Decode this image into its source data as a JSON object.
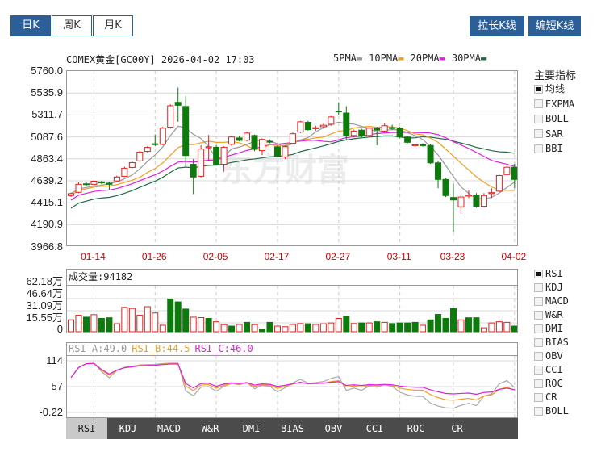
{
  "period_tabs": [
    {
      "label": "日K",
      "active": true
    },
    {
      "label": "周K",
      "active": false
    },
    {
      "label": "月K",
      "active": false
    }
  ],
  "buttons": {
    "stretch": "拉长K线",
    "shorten": "编短K线"
  },
  "chart_title": "COMEX黄金[GC00Y] 2026-04-02 17:03",
  "ma_legend": [
    {
      "label": "5PMA",
      "color": "#9a9a9a"
    },
    {
      "label": "10PMA",
      "color": "#f0a020"
    },
    {
      "label": "20PMA",
      "color": "#e020e0"
    },
    {
      "label": "30PMA",
      "color": "#1f6b45"
    }
  ],
  "price_axis": [
    "5760.0",
    "5535.9",
    "5311.7",
    "5087.6",
    "4863.4",
    "4639.2",
    "4415.1",
    "4190.9",
    "3966.8"
  ],
  "watermark": "东方财富",
  "colors": {
    "up": "#e02020",
    "down": "#0e7a0e"
  },
  "chart_data": {
    "type": "candlestick",
    "ylim": [
      3966.8,
      5760.0
    ],
    "date_ticks": [
      {
        "label": "01-14",
        "index": 3
      },
      {
        "label": "01-26",
        "index": 11
      },
      {
        "label": "02-05",
        "index": 19
      },
      {
        "label": "02-17",
        "index": 27
      },
      {
        "label": "02-27",
        "index": 35
      },
      {
        "label": "03-11",
        "index": 43
      },
      {
        "label": "03-23",
        "index": 50
      },
      {
        "label": "04-02",
        "index": 58
      }
    ],
    "ohlc": [
      [
        4485,
        4515,
        4470,
        4505
      ],
      [
        4518,
        4620,
        4510,
        4600
      ],
      [
        4605,
        4625,
        4585,
        4598
      ],
      [
        4600,
        4640,
        4590,
        4632
      ],
      [
        4625,
        4635,
        4600,
        4615
      ],
      [
        4612,
        4620,
        4543,
        4600
      ],
      [
        4635,
        4690,
        4625,
        4675
      ],
      [
        4682,
        4780,
        4675,
        4765
      ],
      [
        4773,
        4835,
        4765,
        4822
      ],
      [
        4840,
        4945,
        4830,
        4930
      ],
      [
        4937,
        4990,
        4925,
        4978
      ],
      [
        5015,
        5110,
        4990,
        5008
      ],
      [
        5010,
        5190,
        5000,
        5175
      ],
      [
        5185,
        5420,
        5170,
        5405
      ],
      [
        5440,
        5590,
        5240,
        5410
      ],
      [
        5398,
        5500,
        4780,
        4895
      ],
      [
        4805,
        4860,
        4500,
        4675
      ],
      [
        4683,
        5000,
        4670,
        4962
      ],
      [
        4975,
        5105,
        4840,
        4985
      ],
      [
        4980,
        5000,
        4790,
        4805
      ],
      [
        4805,
        4990,
        4730,
        4980
      ],
      [
        5010,
        5100,
        4995,
        5085
      ],
      [
        5075,
        5100,
        5040,
        5050
      ],
      [
        5052,
        5140,
        5040,
        5125
      ],
      [
        5100,
        5110,
        4940,
        4962
      ],
      [
        4945,
        5070,
        4900,
        5060
      ],
      [
        5040,
        5060,
        5020,
        5035
      ],
      [
        4985,
        5000,
        4880,
        4890
      ],
      [
        4880,
        5000,
        4860,
        4985
      ],
      [
        5020,
        5130,
        5010,
        5118
      ],
      [
        5135,
        5250,
        5125,
        5240
      ],
      [
        5235,
        5250,
        5150,
        5160
      ],
      [
        5170,
        5200,
        5150,
        5180
      ],
      [
        5190,
        5220,
        5170,
        5205
      ],
      [
        5215,
        5300,
        5200,
        5290
      ],
      [
        5350,
        5440,
        5310,
        5345
      ],
      [
        5330,
        5400,
        5050,
        5095
      ],
      [
        5100,
        5160,
        5080,
        5145
      ],
      [
        5155,
        5170,
        5080,
        5095
      ],
      [
        5100,
        5185,
        5080,
        5175
      ],
      [
        5170,
        5185,
        5000,
        5155
      ],
      [
        5145,
        5230,
        5130,
        5200
      ],
      [
        5180,
        5210,
        5160,
        5175
      ],
      [
        5175,
        5190,
        5070,
        5085
      ],
      [
        5085,
        5095,
        5020,
        5030
      ],
      [
        5000,
        5020,
        4980,
        5005
      ],
      [
        5005,
        5020,
        4985,
        5000
      ],
      [
        4998,
        5010,
        4810,
        4820
      ],
      [
        4820,
        4840,
        4560,
        4650
      ],
      [
        4650,
        4660,
        4470,
        4485
      ],
      [
        4465,
        4605,
        4115,
        4440
      ],
      [
        4370,
        4490,
        4300,
        4470
      ],
      [
        4480,
        4540,
        4460,
        4490
      ],
      [
        4490,
        4510,
        4360,
        4375
      ],
      [
        4375,
        4510,
        4365,
        4485
      ],
      [
        4505,
        4560,
        4460,
        4515
      ],
      [
        4530,
        4700,
        4520,
        4690
      ],
      [
        4700,
        4790,
        4690,
        4775
      ],
      [
        4775,
        4810,
        4560,
        4650
      ]
    ],
    "volume_wan": [
      20,
      27.6,
      24.4,
      28.6,
      22.3,
      23.4,
      13.3,
      40.8,
      39,
      27.6,
      41.9,
      31.4,
      10.8,
      54.8,
      49.9,
      38,
      24.4,
      23.7,
      22.3,
      16.7,
      11.9,
      9.4,
      12.2,
      15.7,
      11.9,
      4.2,
      15.7,
      9.4,
      8.4,
      12.2,
      13.6,
      13.3,
      12.2,
      13.3,
      14.7,
      22.3,
      26.2,
      13.6,
      14.7,
      14.7,
      16.7,
      15.7,
      13.6,
      14.7,
      14.7,
      15.7,
      10.8,
      19.9,
      29,
      22.3,
      39,
      19.9,
      23.4,
      23.4,
      6.6,
      14.7,
      16.7,
      15.7,
      9.4
    ],
    "volume_up": [
      1,
      1,
      0,
      1,
      0,
      0,
      1,
      1,
      1,
      1,
      1,
      1,
      1,
      0,
      0,
      0,
      1,
      1,
      0,
      1,
      1,
      0,
      1,
      0,
      1,
      0,
      0,
      1,
      1,
      1,
      1,
      0,
      1,
      1,
      1,
      1,
      0,
      1,
      0,
      1,
      0,
      1,
      0,
      0,
      0,
      0,
      1,
      0,
      0,
      0,
      0,
      1,
      0,
      0,
      1,
      1,
      1,
      1,
      0
    ],
    "volume_ylim": [
      0,
      62.18
    ],
    "rsi_ylim": [
      -0.22,
      114
    ]
  },
  "volume": {
    "label": "成交量",
    "value": "94182",
    "axis": [
      "62.18万",
      "46.64万",
      "31.09万",
      "15.55万",
      "0"
    ]
  },
  "rsi": {
    "a_label": "RSI_A:49.0",
    "b_label": "RSI_B:44.5",
    "c_label": "RSI_C:46.0",
    "axis": [
      "114",
      "57",
      "-0.22"
    ]
  },
  "main_indicators": {
    "title": "主要指标",
    "items": [
      {
        "label": "均线",
        "checked": true
      },
      {
        "label": "EXPMA",
        "checked": false
      },
      {
        "label": "BOLL",
        "checked": false
      },
      {
        "label": "SAR",
        "checked": false
      },
      {
        "label": "BBI",
        "checked": false
      }
    ]
  },
  "sub_indicators": [
    {
      "label": "RSI",
      "checked": true
    },
    {
      "label": "KDJ",
      "checked": false
    },
    {
      "label": "MACD",
      "checked": false
    },
    {
      "label": "W&R",
      "checked": false
    },
    {
      "label": "DMI",
      "checked": false
    },
    {
      "label": "BIAS",
      "checked": false
    },
    {
      "label": "OBV",
      "checked": false
    },
    {
      "label": "CCI",
      "checked": false
    },
    {
      "label": "ROC",
      "checked": false
    },
    {
      "label": "CR",
      "checked": false
    },
    {
      "label": "BOLL",
      "checked": false
    }
  ],
  "bottom_tabs": [
    {
      "label": "RSI",
      "active": true
    },
    {
      "label": "KDJ"
    },
    {
      "label": "MACD"
    },
    {
      "label": "W&R"
    },
    {
      "label": "DMI"
    },
    {
      "label": "BIAS"
    },
    {
      "label": "OBV"
    },
    {
      "label": "CCI"
    },
    {
      "label": "ROC"
    },
    {
      "label": "CR"
    }
  ]
}
